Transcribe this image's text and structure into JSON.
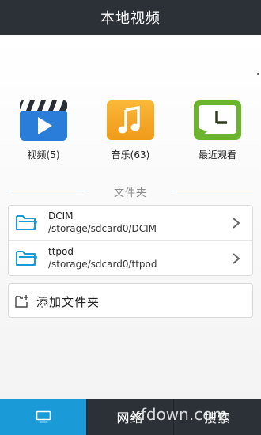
{
  "header": {
    "title": "本地视频"
  },
  "tiles": [
    {
      "label": "视频(5)",
      "icon": "clapperboard-play-icon"
    },
    {
      "label": "音乐(63)",
      "icon": "music-note-icon"
    },
    {
      "label": "最近观看",
      "icon": "clock-icon"
    }
  ],
  "section": {
    "title": "文件夹"
  },
  "folders": [
    {
      "name": "DCIM",
      "path": "/storage/sdcard0/DCIM"
    },
    {
      "name": "ttpod",
      "path": "/storage/sdcard0/ttpod"
    }
  ],
  "add_folder": {
    "label": "添加文件夹"
  },
  "bottom_tabs": [
    {
      "label": "",
      "icon": "monitor-icon",
      "active": true
    },
    {
      "label": "网络"
    },
    {
      "label": "搜索"
    }
  ],
  "watermark": {
    "text": "xfdown.com"
  },
  "colors": {
    "header_bg": "#2b3137",
    "accent": "#1a9ad6",
    "video_icon": "#2a7dd8",
    "music_icon": "#f5a623",
    "recent_icon": "#6bb52e"
  }
}
